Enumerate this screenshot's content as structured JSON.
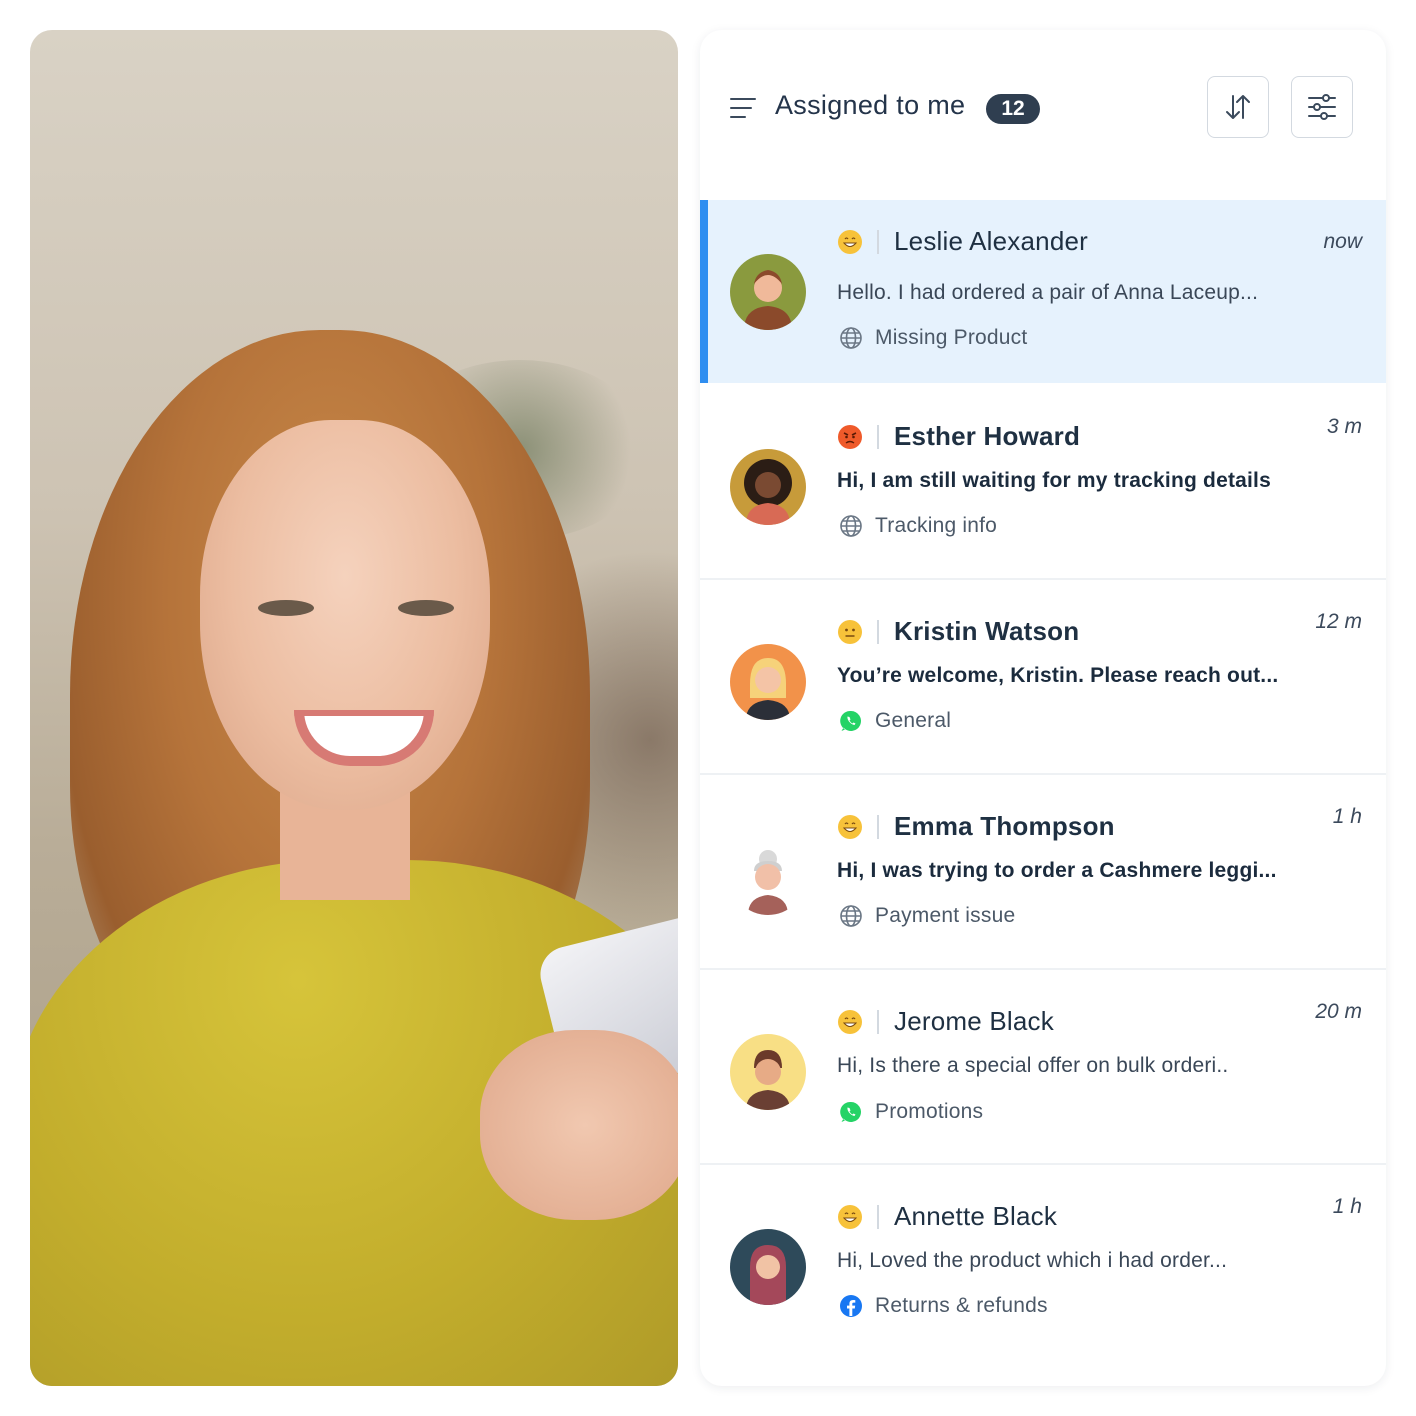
{
  "inbox": {
    "title": "Assigned to me",
    "count": "12"
  },
  "conversations": [
    {
      "name": "Leslie Alexander",
      "time": "now",
      "message": "Hello. I had ordered a pair of Anna Laceup...",
      "tag": "Missing Product",
      "channel": "globe-icon",
      "mood": "grin",
      "unread": false,
      "avatar_bg": "#8a9a3e"
    },
    {
      "name": "Esther Howard",
      "time": "3 m",
      "message": "Hi, I am still waiting for my tracking details",
      "tag": "Tracking info",
      "channel": "globe-icon",
      "mood": "angry",
      "unread": true,
      "avatar_bg": "#c79b3a"
    },
    {
      "name": "Kristin Watson",
      "time": "12 m",
      "message": "You’re welcome, Kristin. Please reach out...",
      "tag": "General",
      "channel": "whatsapp-icon",
      "mood": "neutral",
      "unread": true,
      "avatar_bg": "#f2924a"
    },
    {
      "name": "Emma Thompson",
      "time": "1 h",
      "message": "Hi, I was trying to order a Cashmere leggi...",
      "tag": "Payment issue",
      "channel": "globe-icon",
      "mood": "grin",
      "unread": true,
      "avatar_bg": "#ffffff"
    },
    {
      "name": "Jerome Black",
      "time": "20 m",
      "message": "Hi, Is there a special offer on bulk orderi..",
      "tag": "Promotions",
      "channel": "whatsapp-icon",
      "mood": "grin",
      "unread": false,
      "avatar_bg": "#f8df85"
    },
    {
      "name": "Annette Black",
      "time": "1 h",
      "message": "Hi, Loved the product which i had order...",
      "tag": "Returns & refunds",
      "channel": "facebook-icon",
      "mood": "grin",
      "unread": false,
      "avatar_bg": "#2e4a5a"
    }
  ],
  "colors": {
    "accent": "#2f8ef0",
    "active_row": "#e6f2fd",
    "badge": "#2f3e50",
    "whatsapp": "#25d366",
    "facebook": "#1877f2"
  }
}
